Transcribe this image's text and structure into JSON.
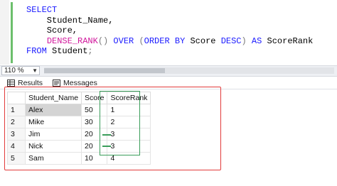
{
  "editor": {
    "line1": "SELECT",
    "line2": "    Student_Name,",
    "line3": "    Score,",
    "line4_fn": "DENSE_RANK",
    "line4_paren": "()",
    "line4_over": " OVER ",
    "line4_open": "(",
    "line4_order": "ORDER BY",
    "line4_col": " Score ",
    "line4_desc": "DESC",
    "line4_close": ")",
    "line4_as": " AS",
    "line4_alias": " ScoreRank",
    "line5_from": "FROM",
    "line5_table": " Student",
    "line5_semi": ";"
  },
  "zoom": {
    "value": "110 %"
  },
  "tabs": {
    "results": "Results",
    "messages": "Messages"
  },
  "grid": {
    "columns": [
      "Student_Name",
      "Score",
      "ScoreRank"
    ],
    "rows": [
      {
        "num": "1",
        "name": "Alex",
        "score": "50",
        "rank": "1"
      },
      {
        "num": "2",
        "name": "Mike",
        "score": "30",
        "rank": "2"
      },
      {
        "num": "3",
        "name": "Jim",
        "score": "20",
        "rank": "3"
      },
      {
        "num": "4",
        "name": "Nick",
        "score": "20",
        "rank": "3"
      },
      {
        "num": "5",
        "name": "Sam",
        "score": "10",
        "rank": "4"
      }
    ]
  }
}
